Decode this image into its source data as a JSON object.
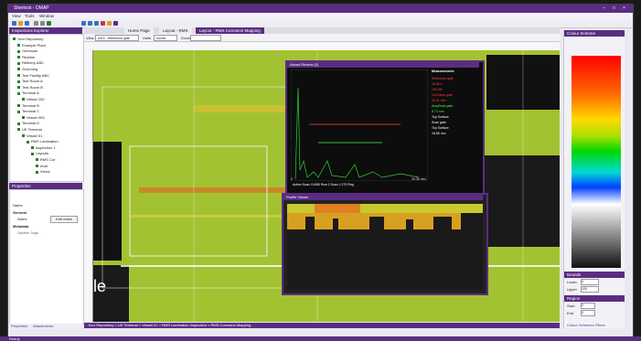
{
  "window": {
    "title": "Sherlock - OMAP",
    "controls": [
      "–",
      "□",
      "×"
    ]
  },
  "menu": [
    "View",
    "Tools",
    "Window"
  ],
  "toolbar": {
    "icons": [
      "new-icon",
      "open-icon",
      "save-icon",
      "cut-icon",
      "copy-icon",
      "paste-icon",
      "zoom-in-icon",
      "zoom-out-icon",
      "grid-icon",
      "measure-icon",
      "palette-icon",
      "settings-icon"
    ]
  },
  "explorer": {
    "title": "Inspections Explorer",
    "items": [
      {
        "label": "Your Repository",
        "depth": 0
      },
      {
        "label": "Example Plant",
        "depth": 1
      },
      {
        "label": "Onmozan",
        "depth": 1
      },
      {
        "label": "Pipeline",
        "depth": 1
      },
      {
        "label": "Refinery ABC",
        "depth": 1
      },
      {
        "label": "Shorming",
        "depth": 1
      },
      {
        "label": "Test Facility ABC",
        "depth": 1
      },
      {
        "label": "Test Room A",
        "depth": 1
      },
      {
        "label": "Test Room B",
        "depth": 1
      },
      {
        "label": "Terminal A",
        "depth": 1
      },
      {
        "label": "Vessel 152",
        "depth": 2
      },
      {
        "label": "Terminal B",
        "depth": 1
      },
      {
        "label": "Terminal C",
        "depth": 1
      },
      {
        "label": "Vessel 403",
        "depth": 2
      },
      {
        "label": "Terminal D",
        "depth": 1
      },
      {
        "label": "UK Terminal",
        "depth": 1
      },
      {
        "label": "Vessel 01",
        "depth": 2
      },
      {
        "label": "RMS Lamination",
        "depth": 3
      },
      {
        "label": "Inspection 1",
        "depth": 4
      },
      {
        "label": "Layouts",
        "depth": 4
      },
      {
        "label": "RMS Cor",
        "depth": 5
      },
      {
        "label": "Anal",
        "depth": 5
      },
      {
        "label": "Views",
        "depth": 5
      }
    ]
  },
  "properties": {
    "title": "Properties",
    "name_label": "Name",
    "general_label": "General",
    "notes_label": "Notes",
    "edit_notes": "Edit notes",
    "metadata_label": "Metadata",
    "system_tags": "System Tags",
    "tabs": [
      "Properties",
      "Attachments"
    ]
  },
  "doctabs": [
    "Home Page",
    "Layout - RMS",
    "Layout - RMS Corrosion Mapping"
  ],
  "options": {
    "view_label": "View",
    "view_value": "InDX - Reference gate",
    "units_label": "Units",
    "units_value": "Inches",
    "zoom_label": "Zoom"
  },
  "map": {
    "big_letters": "le",
    "breadcrumb": "Your Repository > UK Terminal > Vessel 01 > RMS Lamination Inspection > RMS Corrosion Mapping"
  },
  "ascan": {
    "title": "Ascan Review (2)",
    "active_scan": "Active Scan:  D4/80 Row 2 Scan 1.270 Reg",
    "measurements_title": "Measurements",
    "measurements": [
      {
        "text": "Reference gate",
        "color": "#ff4040"
      },
      {
        "text": "18.86 s",
        "color": "#ff4040"
      },
      {
        "text": "100.0%",
        "color": "#ff4040"
      },
      {
        "text": "Corrosion gate",
        "color": "#ff4040"
      },
      {
        "text": "22.01 mm",
        "color": "#ff4040"
      },
      {
        "text": "Amplitude gate",
        "color": "#40ff40"
      },
      {
        "text": "8.73 mm",
        "color": "#40ff40"
      },
      {
        "text": "Top Surface",
        "color": "#ffffff"
      },
      {
        "text": "Scan gate",
        "color": "#ffffff"
      },
      {
        "text": "Top Surface",
        "color": "#ffffff"
      },
      {
        "text": "18.85 mm",
        "color": "#ffffff"
      }
    ],
    "x_min": "0",
    "x_max": "30.36 mm"
  },
  "profile": {
    "title": "Profile Viewer"
  },
  "colour_scheme": {
    "title": "Colour Scheme",
    "bounds_label": "Bounds",
    "lower_label": "Lower",
    "lower_value": "0",
    "upper_label": "Upper",
    "upper_value": "100",
    "region_label": "Region",
    "start_label": "Start",
    "start_value": "0",
    "end_label": "End",
    "end_value": "0",
    "tabs": [
      "Colour Schemes",
      "Filters"
    ]
  },
  "status": "Ready",
  "colors": {
    "accent": "#5a2d82",
    "map_green": "#9fbf30"
  }
}
